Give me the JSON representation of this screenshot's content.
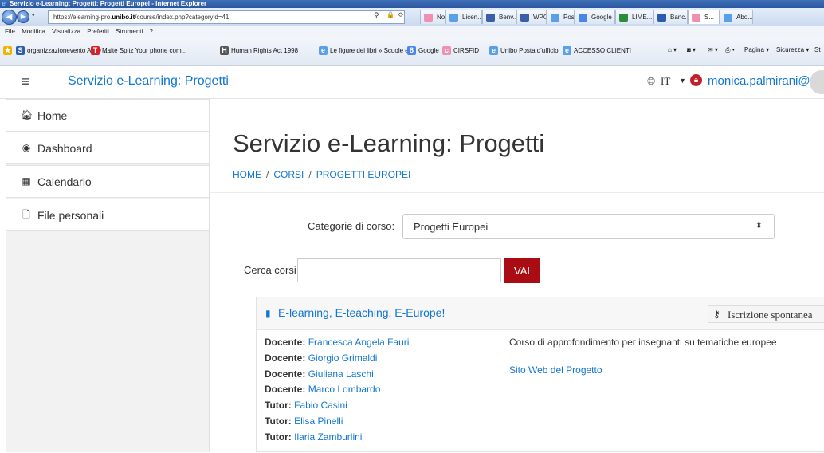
{
  "browser": {
    "window_title": "Servizio e-Learning: Progetti: Progetti Europei - Internet Explorer",
    "url_prefix": "https://elearning-pro.",
    "url_domain": "unibo.it",
    "url_path": "/course/index.php?categoryid=41",
    "tabs": [
      {
        "label": "Nor...",
        "color": "#f08fb0"
      },
      {
        "label": "Licen...",
        "color": "#5aa0e6"
      },
      {
        "label": "Benv...",
        "color": "#3b5ea8"
      },
      {
        "label": "WPO...",
        "color": "#3b5ea8"
      },
      {
        "label": "Post...",
        "color": "#5aa0e6"
      },
      {
        "label": "Google",
        "color": "#4a85e8"
      },
      {
        "label": "LIME...",
        "color": "#2b8c3a"
      },
      {
        "label": "Banc...",
        "color": "#2a5cb0"
      },
      {
        "label": "S...",
        "color": "#f08fb0"
      },
      {
        "label": "Abo...",
        "color": "#5aa0e6"
      }
    ],
    "menu": [
      "File",
      "Modifica",
      "Visualizza",
      "Preferiti",
      "Strumenti",
      "?"
    ],
    "favorites": [
      {
        "label": "organizzazionevento AgID -...",
        "color": "#2a5cb0",
        "glyph": "S"
      },
      {
        "label": "Malte Spitz Your phone com...",
        "color": "#d8202a",
        "glyph": "T"
      },
      {
        "label": "Human Rights Act 1998",
        "color": "#555555",
        "glyph": "H"
      },
      {
        "label": "Le figure dei libri » Scuole e ...",
        "color": "#5aa0e6",
        "glyph": "e"
      },
      {
        "label": "Google",
        "color": "#4a85e8",
        "glyph": "8"
      },
      {
        "label": "CIRSFID",
        "color": "#f08fb0",
        "glyph": "c"
      },
      {
        "label": "Unibo Posta d'ufficio",
        "color": "#5aa0e6",
        "glyph": "e"
      },
      {
        "label": "ACCESSO CLIENTI",
        "color": "#5aa0e6",
        "glyph": "e"
      }
    ],
    "tools": [
      "Pagina ▾",
      "Sicurezza ▾",
      "St"
    ]
  },
  "header": {
    "site_name": "Servizio e-Learning: Progetti",
    "language": "IT",
    "user": "monica.palmirani@unibo.it"
  },
  "sidebar": {
    "items": [
      {
        "label": "Home",
        "icon": "home-icon"
      },
      {
        "label": "Dashboard",
        "icon": "dashboard-icon"
      },
      {
        "label": "Calendario",
        "icon": "calendar-icon"
      },
      {
        "label": "File personali",
        "icon": "file-icon"
      }
    ]
  },
  "main": {
    "page_title": "Servizio e-Learning: Progetti",
    "breadcrumb": [
      "HOME",
      "CORSI",
      "PROGETTI EUROPEI"
    ],
    "category_label": "Categorie di corso:",
    "category_value": "Progetti Europei",
    "search_label": "Cerca corsi",
    "search_value": "",
    "search_button": "VAI"
  },
  "course": {
    "title": "E-learning, E-teaching, E-Europe!",
    "enrol_label": "Iscrizione spontanea",
    "staff": [
      {
        "role": "Docente:",
        "name": "Francesca Angela Fauri"
      },
      {
        "role": "Docente:",
        "name": "Giorgio Grimaldi"
      },
      {
        "role": "Docente:",
        "name": "Giuliana Laschi"
      },
      {
        "role": "Docente:",
        "name": "Marco Lombardo"
      },
      {
        "role": "Tutor:",
        "name": "Fabio Casini"
      },
      {
        "role": "Tutor:",
        "name": "Elisa Pinelli"
      },
      {
        "role": "Tutor:",
        "name": "Ilaria Zamburlini"
      }
    ],
    "summary": "Corso di approfondimento per insegnanti su tematiche europee",
    "project_link": "Sito Web del Progetto"
  }
}
